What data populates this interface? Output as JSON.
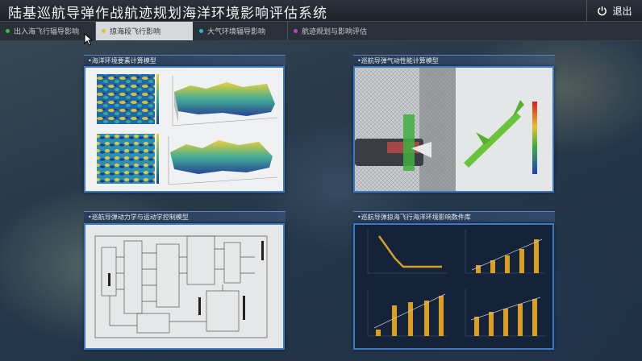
{
  "header": {
    "title": "陆基巡航导弹作战航迹规划海洋环境影响评估系统",
    "logout_label": "退出",
    "logout_icon": "power-icon"
  },
  "tabs": [
    {
      "label": "出入海飞行辐导影响",
      "color": "#3fbf3f",
      "active": false
    },
    {
      "label": "掠海段飞行影响",
      "color": "#e0c030",
      "active": true
    },
    {
      "label": "大气环境辐导影响",
      "color": "#2fb8d8",
      "active": false
    },
    {
      "label": "航迹规划与影响评估",
      "color": "#c040c0",
      "active": false
    }
  ],
  "panels": {
    "ocean": {
      "title": "•海洋环境要素计算模型"
    },
    "aero": {
      "title": "•巡航导弹气动性能计算模型"
    },
    "dynamics": {
      "title": "•巡航导弹动力学与运动学控制模型"
    },
    "charts": {
      "title": "•巡航导弹掠海飞行海洋环境影响数件库"
    }
  },
  "colors": {
    "accent_border": "#3b79c7",
    "chart_bar": "#d9a021",
    "chart_bg": "#14233a"
  }
}
